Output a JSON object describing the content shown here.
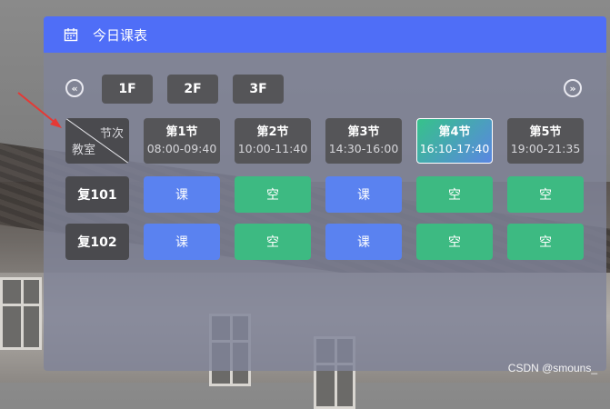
{
  "header": {
    "title": "今日课表",
    "icon": "calendar-icon"
  },
  "floors": {
    "prev": "«",
    "next": "»",
    "items": [
      "1F",
      "2F",
      "3F"
    ]
  },
  "corner": {
    "top_label": "节次",
    "bottom_label": "教室"
  },
  "periods": [
    {
      "name": "第1节",
      "time": "08:00-09:40",
      "current": false
    },
    {
      "name": "第2节",
      "time": "10:00-11:40",
      "current": false
    },
    {
      "name": "第3节",
      "time": "14:30-16:00",
      "current": false
    },
    {
      "name": "第4节",
      "time": "16:10-17:40",
      "current": true
    },
    {
      "name": "第5节",
      "time": "19:00-21:35",
      "current": false
    }
  ],
  "rooms": [
    {
      "name": "复101",
      "slots": [
        "课",
        "空",
        "课",
        "空",
        "空"
      ]
    },
    {
      "name": "复102",
      "slots": [
        "课",
        "空",
        "课",
        "空",
        "空"
      ]
    }
  ],
  "colors": {
    "header": "#4f6ef7",
    "class_slot": "#5a82f0",
    "free_slot": "#3dba82",
    "arrow": "#e53935"
  },
  "watermark": "CSDN @smouns_"
}
